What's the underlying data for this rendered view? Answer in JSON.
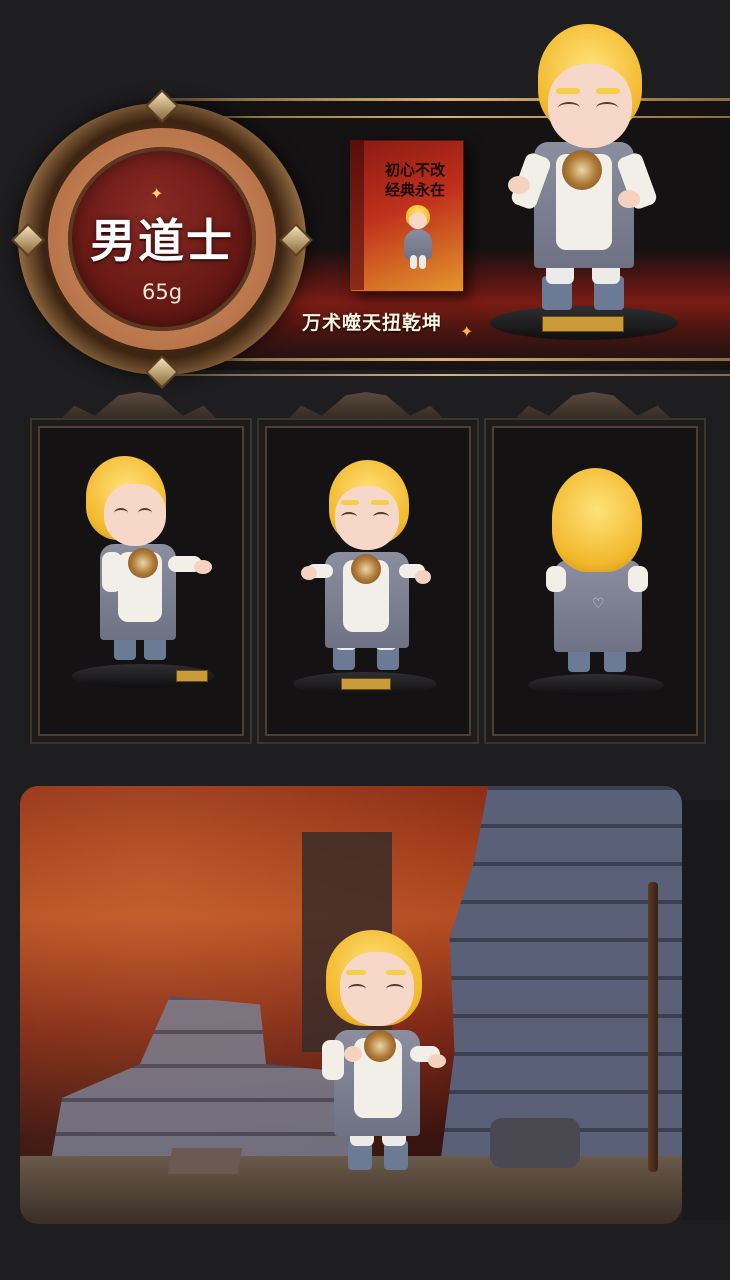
{
  "banner": {
    "title": "男道士",
    "weight": "65g",
    "slogan": "万术噬天扭乾坤",
    "box_text": "初心不改\n经典永在"
  },
  "panels": [
    {
      "view": "side view"
    },
    {
      "view": "front view"
    },
    {
      "view": "back view"
    }
  ],
  "colors": {
    "background": "#1e1d1f",
    "gold": "#d8b37a",
    "medallion_red": "#6a1a16",
    "hair": "#f2b82c"
  }
}
